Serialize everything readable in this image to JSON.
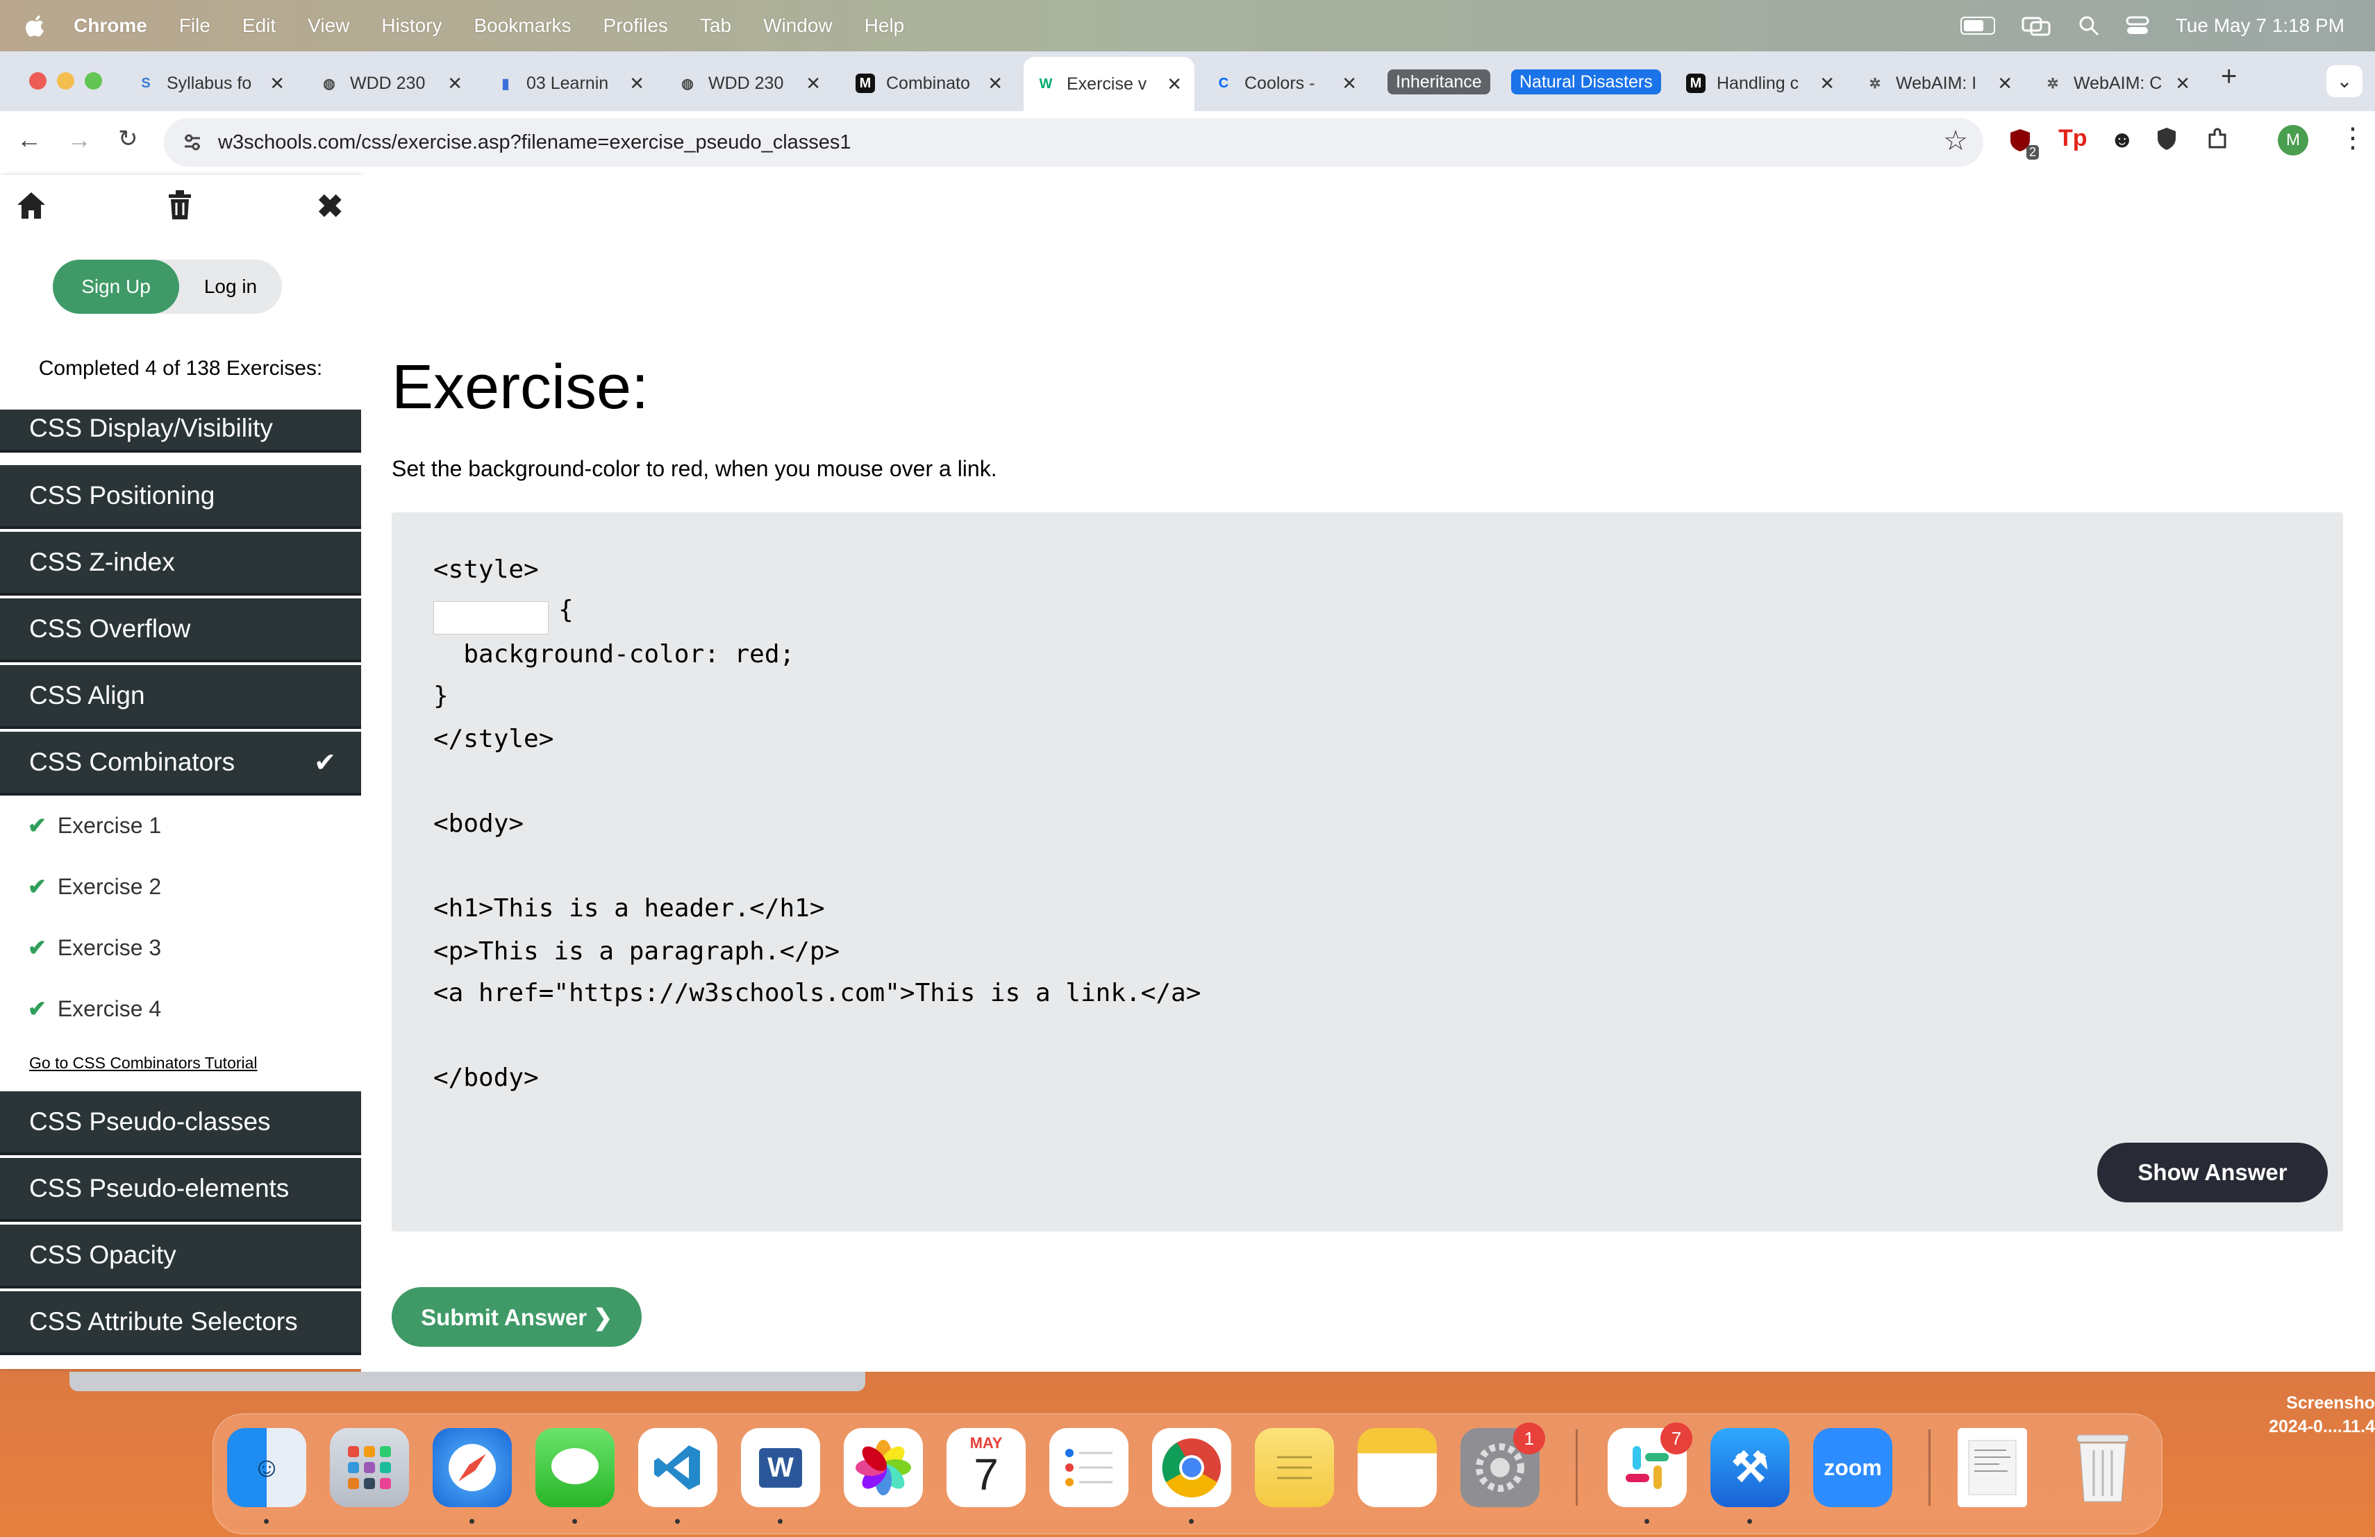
{
  "menubar": {
    "app": "Chrome",
    "items": [
      "File",
      "Edit",
      "View",
      "History",
      "Bookmarks",
      "Profiles",
      "Tab",
      "Window",
      "Help"
    ],
    "datetime": "Tue May 7  1:18 PM"
  },
  "tabs": [
    {
      "title": "Syllabus fo",
      "fav": "S"
    },
    {
      "title": "WDD 230",
      "fav": "◍"
    },
    {
      "title": "03 Learnin",
      "fav": "▮"
    },
    {
      "title": "WDD 230",
      "fav": "◍"
    },
    {
      "title": "Combinato",
      "fav": "M"
    },
    {
      "title": "Exercise v",
      "fav": "W"
    },
    {
      "title": "Coolors -",
      "fav": "C"
    }
  ],
  "tab_groups": [
    "Inheritance",
    "Natural Disasters"
  ],
  "tabs_after": [
    {
      "title": "Handling c",
      "fav": "M"
    },
    {
      "title": "WebAIM: I",
      "fav": "✲"
    },
    {
      "title": "WebAIM: C",
      "fav": "✲"
    }
  ],
  "url": "w3schools.com/css/exercise.asp?filename=exercise_pseudo_classes1",
  "profile_initial": "M",
  "extension_badge": "2",
  "sidebar": {
    "signup": "Sign Up",
    "login": "Log in",
    "completed": "Completed 4 of 138 Exercises:",
    "categories_top": [
      "CSS Display/Visibility",
      "CSS Positioning",
      "CSS Z-index",
      "CSS Overflow",
      "CSS Align",
      "CSS Combinators"
    ],
    "exercises": [
      "Exercise 1",
      "Exercise 2",
      "Exercise 3",
      "Exercise 4"
    ],
    "tutorial_link": "Go to CSS Combinators Tutorial",
    "categories_bottom": [
      "CSS Pseudo-classes",
      "CSS Pseudo-elements",
      "CSS Opacity",
      "CSS Attribute Selectors"
    ]
  },
  "main": {
    "title": "Exercise:",
    "instruction": "Set the background-color to red, when you mouse over a link.",
    "code": {
      "l1": "<style>",
      "l2": "{",
      "l3": "  background-color: red;",
      "l4": "}",
      "l5": "</style>",
      "l6": "<body>",
      "l7": "<h1>This is a header.</h1>",
      "l8": "<p>This is a paragraph.</p>",
      "l9": "<a href=\"https://w3schools.com\">This is a link.</a>",
      "l10": "</body>"
    },
    "show_answer": "Show Answer",
    "submit": "Submit Answer ❯"
  },
  "dock": {
    "calendar_month": "MAY",
    "calendar_day": "7",
    "settings_badge": "1",
    "slack_badge": "7",
    "zoom_label": "zoom"
  },
  "screenshot_label": {
    "line1": "Screensho",
    "line2": "2024-0....11.4"
  }
}
